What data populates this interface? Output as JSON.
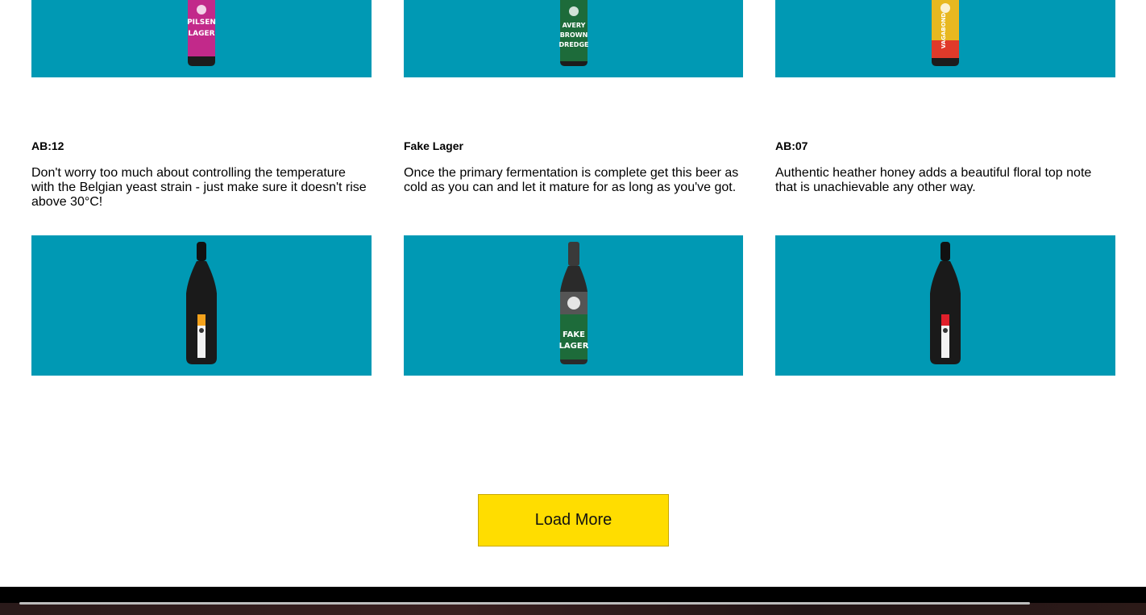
{
  "top_row": [
    {
      "bottle": "pilsen-lager-bottle",
      "label_color": "#c2298a",
      "label_text": "PILSEN LAGER"
    },
    {
      "bottle": "avery-brown-dredge-bottle",
      "label_color": "#1d6b3a",
      "label_text": "AVERY BROWN DREDGE"
    },
    {
      "bottle": "vagabond-pilsner-bottle",
      "label_color": "#e03a2a",
      "label_text": "VAGABOND PILSNER"
    }
  ],
  "middle_row": [
    {
      "title": "AB:12",
      "description": "Don't worry too much about controlling the temperature with the Belgian yeast strain - just make sure it doesn't rise above 30°C!",
      "bottle": "ab12-bottle",
      "label_color": "#f4a21c"
    },
    {
      "title": "Fake Lager",
      "description": "Once the primary fermentation is complete get this beer as cold as you can and let it mature for as long as you've got.",
      "bottle": "fake-lager-bottle",
      "label_color": "#1d6b3a",
      "label_text": "FAKE LAGER"
    },
    {
      "title": "AB:07",
      "description": "Authentic heather honey adds a beautiful floral top note that is unachievable any other way.",
      "bottle": "ab07-bottle",
      "label_color": "#e0202b"
    }
  ],
  "load_more": {
    "label": "Load More"
  },
  "colors": {
    "card_bg": "#0099b4",
    "button_bg": "#ffdd00",
    "footer_bg": "#000000"
  }
}
